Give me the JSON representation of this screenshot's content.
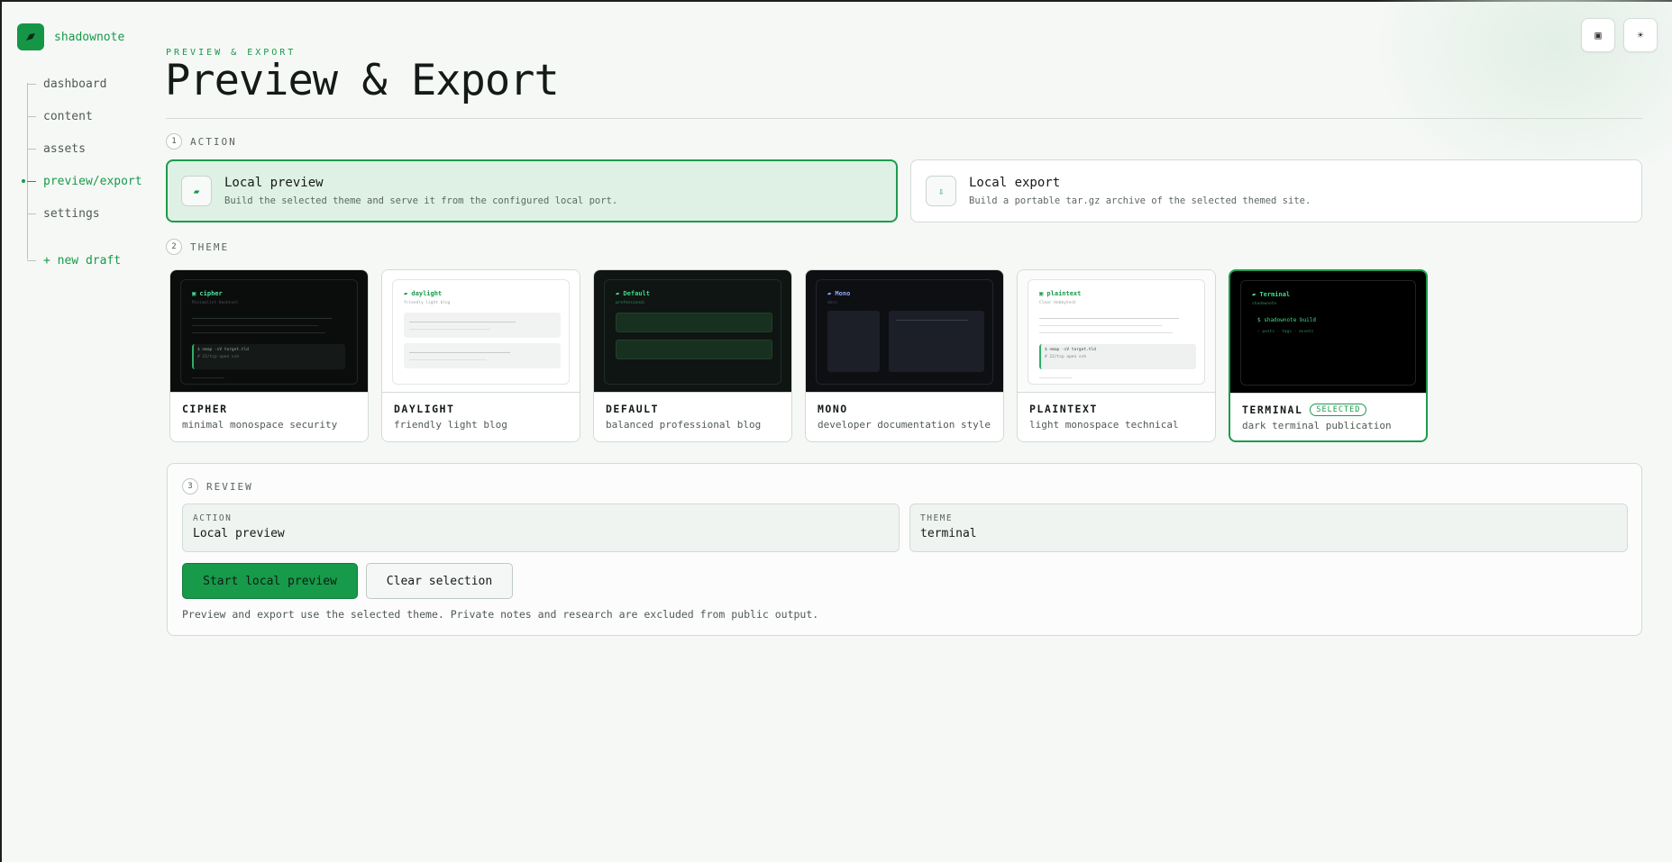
{
  "app": {
    "name": "shadownote",
    "logo_icon": "leaf-icon",
    "accent": "#179a4a"
  },
  "sidebar": {
    "items": [
      {
        "label": "dashboard"
      },
      {
        "label": "content"
      },
      {
        "label": "assets"
      },
      {
        "label": "preview/export",
        "active": true
      },
      {
        "label": "settings"
      }
    ],
    "new_draft": "+ new draft"
  },
  "topbar": {
    "buttons": [
      "panel-toggle-icon",
      "theme-toggle-icon"
    ]
  },
  "header": {
    "eyebrow": "PREVIEW & EXPORT",
    "title": "Preview & Export"
  },
  "steps": {
    "action": {
      "num": "1",
      "label": "ACTION"
    },
    "theme": {
      "num": "2",
      "label": "THEME"
    },
    "review": {
      "num": "3",
      "label": "REVIEW"
    }
  },
  "actions": [
    {
      "title": "Local preview",
      "desc": "Build the selected theme and serve it from the configured local port.",
      "icon": "leaf-icon",
      "selected": true
    },
    {
      "title": "Local export",
      "desc": "Build a portable tar.gz archive of the selected themed site.",
      "icon": "download-icon",
      "selected": false
    }
  ],
  "themes": [
    {
      "name": "CIPHER",
      "desc": "minimal monospace security",
      "preview_title": "▣ cipher",
      "preview_sub": "Minimalist Hacktool",
      "cmd1": "$ nmap -sV target.tld",
      "cmd2": "# 22/tcp open ssh"
    },
    {
      "name": "DAYLIGHT",
      "desc": "friendly light blog",
      "preview_title": "▰ daylight",
      "preview_sub": "friendly light blog"
    },
    {
      "name": "DEFAULT",
      "desc": "balanced professional blog",
      "preview_title": "▰ Default",
      "preview_sub": "professional"
    },
    {
      "name": "MONO",
      "desc": "developer documentation style",
      "preview_title": "▰ Mono",
      "preview_sub": "docs"
    },
    {
      "name": "PLAINTEXT",
      "desc": "light monospace technical",
      "preview_title": "▣ plaintext",
      "preview_sub": "Clear Hobbytech",
      "cmd1": "$ nmap -sV target.tld",
      "cmd2": "# 22/tcp open ssh"
    },
    {
      "name": "TERMINAL",
      "desc": "dark terminal publication",
      "preview_title": "▰ Terminal",
      "preview_sub": "shadownote",
      "cmd1": "$ shadownote build",
      "cmd2": "✓ posts · tags · assets",
      "selected": true,
      "badge": "SELECTED"
    }
  ],
  "review": {
    "action_label": "ACTION",
    "action_value": "Local preview",
    "theme_label": "THEME",
    "theme_value": "terminal",
    "primary_button": "Start local preview",
    "secondary_button": "Clear selection",
    "note": "Preview and export use the selected theme. Private notes and research are excluded from public output."
  }
}
